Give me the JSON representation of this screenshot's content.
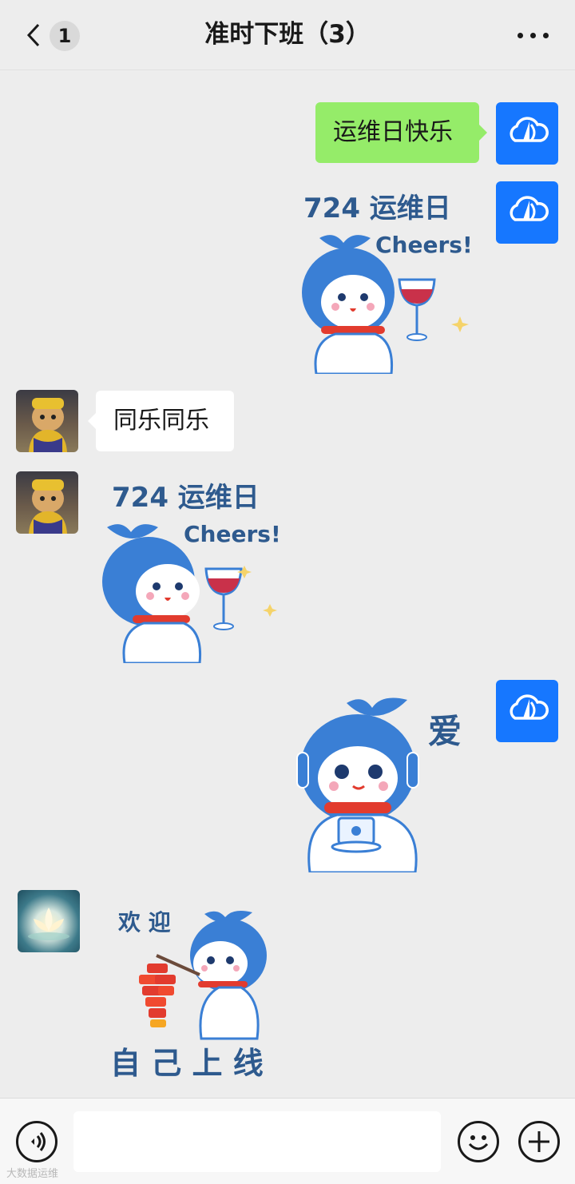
{
  "header": {
    "unread_count": "1",
    "title": "准时下班（3）"
  },
  "messages": {
    "m1_text": "运维日快乐",
    "m2_sticker": {
      "line1": "724 运维日",
      "line2": "Cheers!"
    },
    "m3_text": "同乐同乐",
    "m4_sticker": {
      "line1": "724 运维日",
      "line2": "Cheers!"
    },
    "m5_sticker": {
      "caption": "爱"
    },
    "m6_sticker": {
      "top": "欢 迎",
      "bottom": "自 己 上 线"
    }
  },
  "footer": {
    "watermark": "大数据运维"
  },
  "colors": {
    "background": "#ededed",
    "outgoing_bubble": "#95ec69",
    "incoming_bubble": "#ffffff",
    "brand_avatar": "#1677ff",
    "mascot_blue": "#3a7fd5",
    "scarf_red": "#e23b2e"
  },
  "icons": {
    "back": "chevron-left-icon",
    "more": "ellipsis-icon",
    "voice": "voice-icon",
    "emoji": "emoji-icon",
    "plus": "plus-icon",
    "brand_avatar": "cloud-sail-logo"
  }
}
